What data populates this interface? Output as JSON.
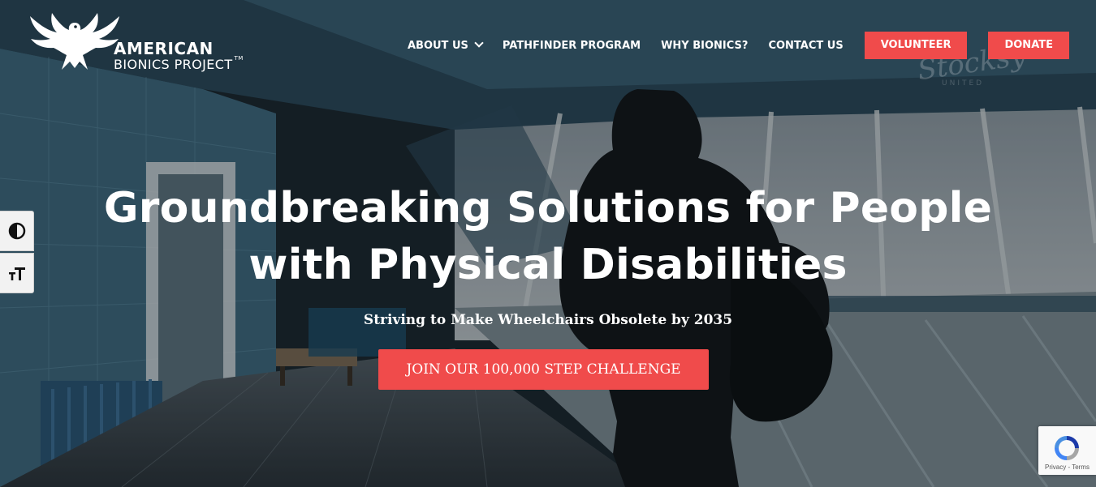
{
  "brand": {
    "line1": "AMERICAN",
    "line2": "BIONICS PROJECT",
    "tm": "TM"
  },
  "nav": {
    "about": "ABOUT US",
    "pathfinder": "PATHFINDER PROGRAM",
    "why": "WHY BIONICS?",
    "contact": "CONTACT US",
    "volunteer": "VOLUNTEER",
    "donate": "DONATE"
  },
  "accessibility": {
    "contrast_icon": "contrast-icon",
    "font_icon": "font-size-icon"
  },
  "hero": {
    "headline_line1": "Groundbreaking Solutions for People",
    "headline_line2": "with Physical Disabilities",
    "subheadline": "Striving to Make Wheelchairs Obsolete by 2035",
    "cta": "JOIN OUR 100,000 STEP CHALLENGE",
    "watermark": "Stocksy",
    "watermark_sub": "UNITED"
  },
  "recaptcha": {
    "links": "Privacy - Terms"
  },
  "colors": {
    "accent": "#f04b4b",
    "text": "#ffffff"
  }
}
